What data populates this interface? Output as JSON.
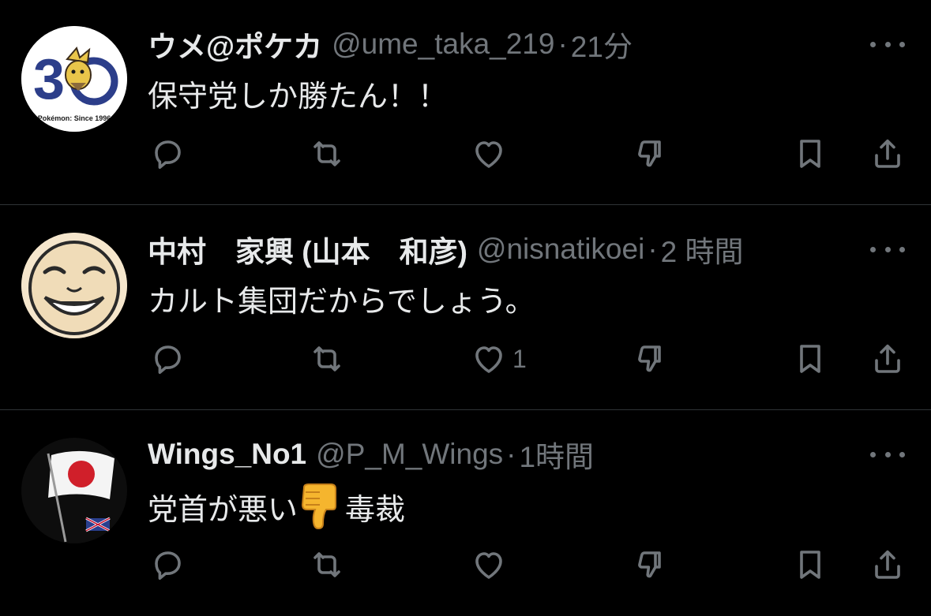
{
  "tweets": [
    {
      "display_name": "ウメ@ポケカ",
      "handle": "@ume_taka_219",
      "separator": "·",
      "time": "21分",
      "text": "保守党しか勝たん！！",
      "avatar": {
        "label_number": "30",
        "label_caption": "Pokémon: Since 1996",
        "icon": "pokemon-30th-logo-icon"
      },
      "like_count": ""
    },
    {
      "display_name": "中村　家興 (山本　和彦)",
      "handle": "@nisnatikoei",
      "separator": "·",
      "time": "2 時間",
      "text": "カルト集団だからでしょう。",
      "avatar": {
        "icon": "laughing-face-icon"
      },
      "like_count": "1"
    },
    {
      "display_name": "Wings_No1",
      "handle": "@P_M_Wings",
      "separator": "·",
      "time": "1時間",
      "text_before": "党首が悪い",
      "emoji": "thumbs-down-emoji-icon",
      "text_after": "毒裁",
      "avatar": {
        "icon": "japan-flag-icon"
      },
      "like_count": ""
    }
  ],
  "icons": {
    "reply": "reply-icon",
    "retweet": "retweet-icon",
    "like": "heart-icon",
    "dislike": "thumbs-down-icon",
    "bookmark": "bookmark-icon",
    "share": "share-icon",
    "more": "more-options-icon"
  },
  "colors": {
    "background": "#000000",
    "primary_text": "#e7e9ea",
    "secondary_text": "#71767b",
    "divider": "#2f3336",
    "emoji": "#f5b52e"
  }
}
